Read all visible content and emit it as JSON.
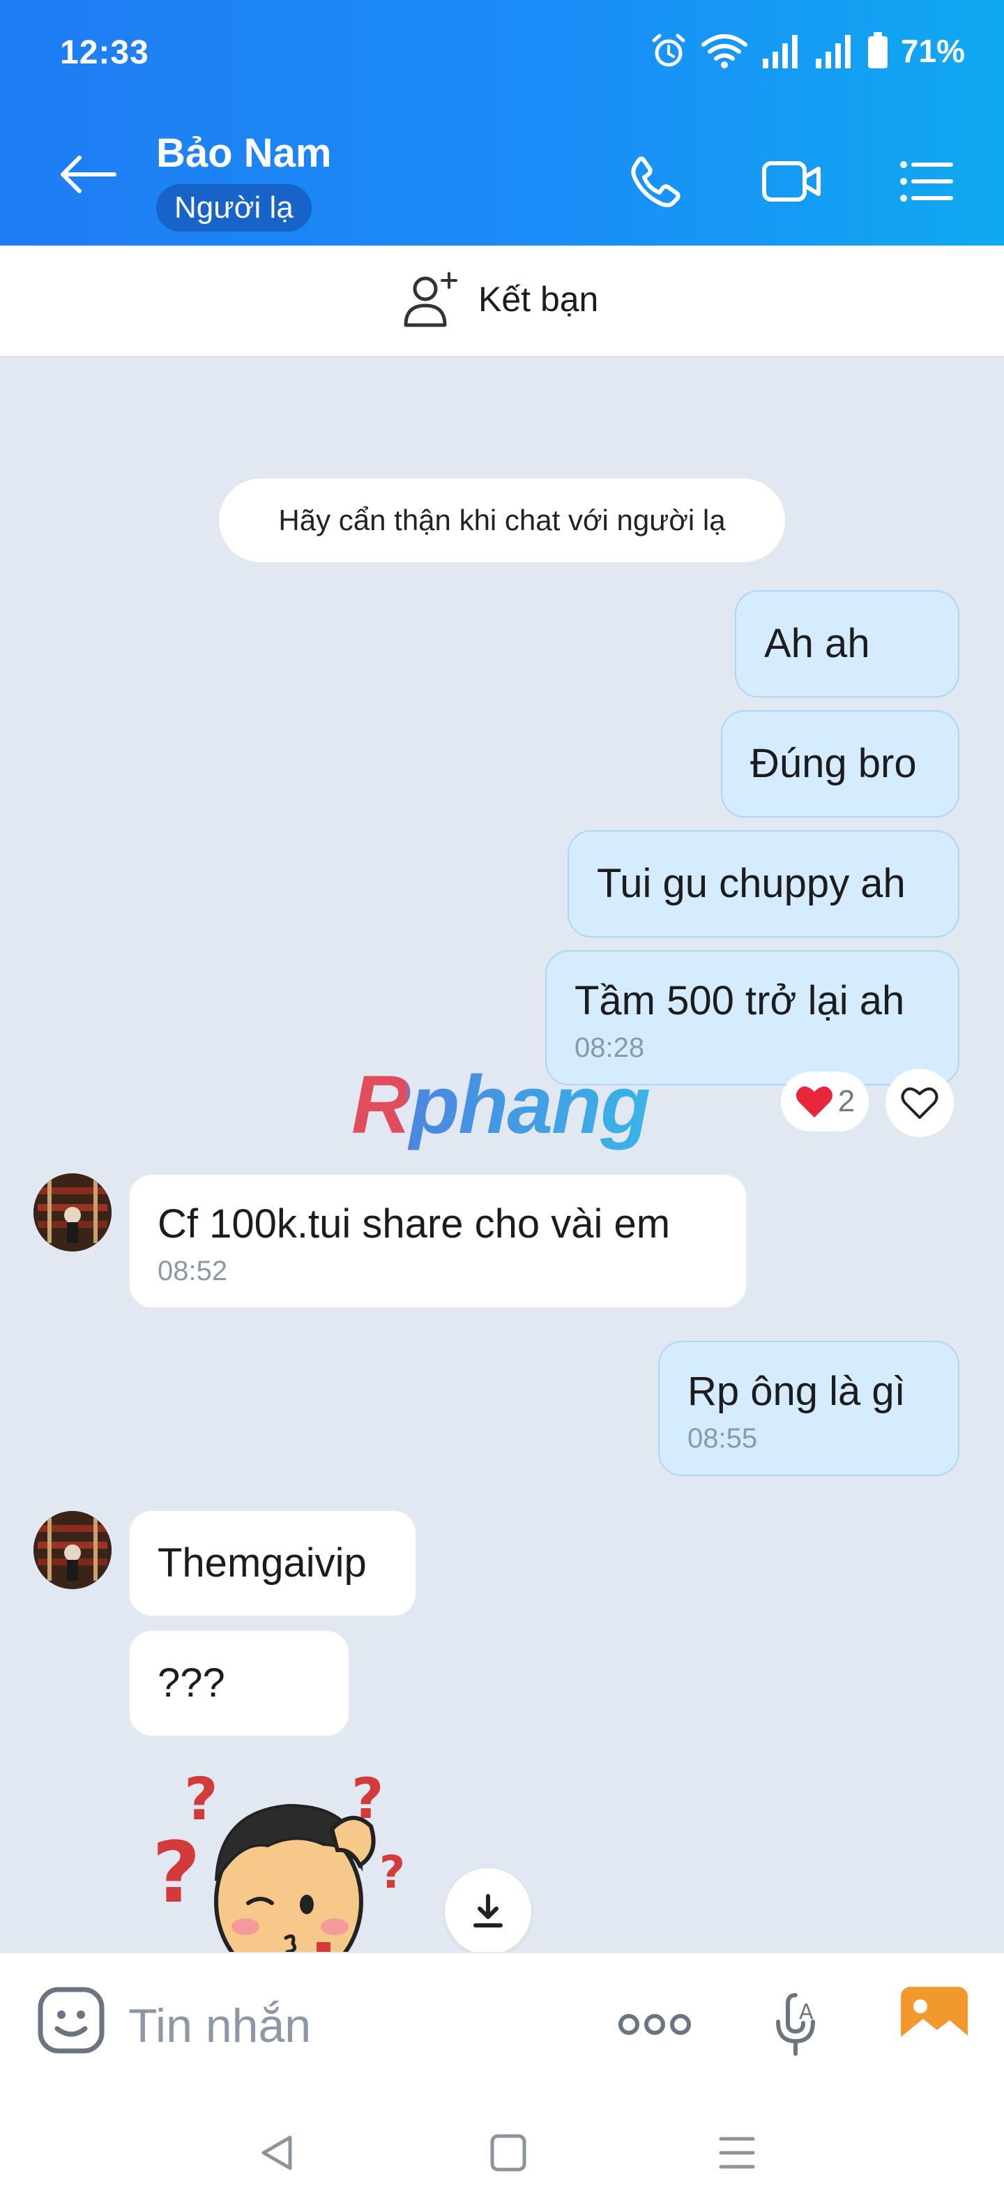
{
  "status_bar": {
    "time": "12:33",
    "battery_percent": "71%",
    "icons": [
      "alarm-icon",
      "wifi-icon",
      "signal-icon",
      "signal-icon",
      "battery-icon"
    ]
  },
  "header": {
    "contact_name": "Bảo Nam",
    "badge": "Người lạ",
    "actions": [
      "phone-call-icon",
      "video-call-icon",
      "menu-list-icon"
    ]
  },
  "add_friend": {
    "label": "Kết bạn"
  },
  "chat": {
    "notice": "Hãy cẩn thận khi chat với người lạ",
    "messages": [
      {
        "from": "me",
        "text": "Ah ah"
      },
      {
        "from": "me",
        "text": "Đúng bro"
      },
      {
        "from": "me",
        "text": "Tui gu chuppy ah"
      },
      {
        "from": "me",
        "text": "Tầm 500 trở lại ah",
        "time": "08:28"
      },
      {
        "from": "them",
        "text": "Cf 100k.tui share cho vài em",
        "time": "08:52"
      },
      {
        "from": "me",
        "text": "Rp ông là gì",
        "time": "08:55"
      },
      {
        "from": "them",
        "text": "Themgaivip"
      },
      {
        "from": "them",
        "text": "???"
      }
    ],
    "reaction": {
      "emoji": "heart",
      "count": "2"
    },
    "watermark": "Rphang"
  },
  "composer": {
    "placeholder": "Tin nhắn"
  },
  "colors": {
    "header_gradient_start": "#1f7df3",
    "header_gradient_end": "#10a9f1",
    "my_bubble": "#d4ecfd",
    "chat_background": "#e2e8f1",
    "heart": "#e8283a"
  }
}
